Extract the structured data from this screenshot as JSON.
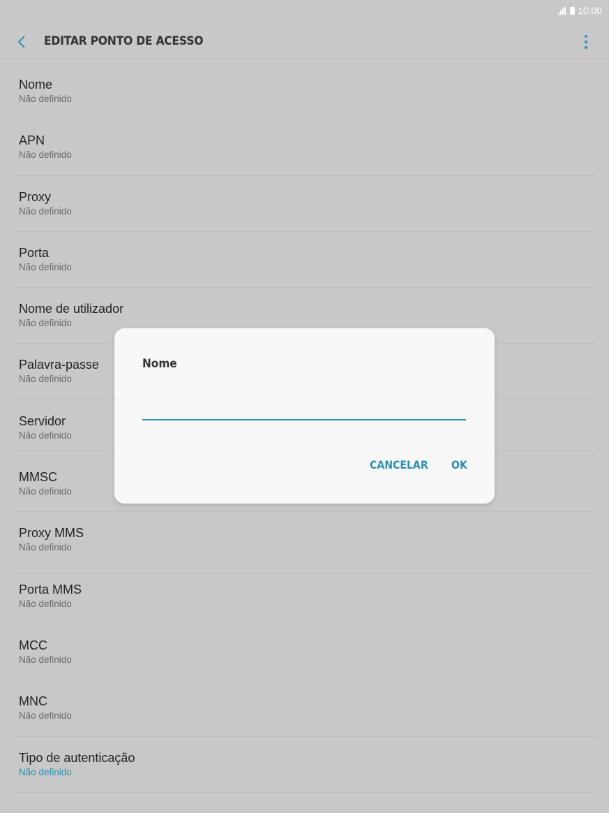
{
  "status_bar": {
    "time": "10:00"
  },
  "header": {
    "title": "EDITAR PONTO DE ACESSO",
    "back_icon": "chevron-left-icon",
    "menu_icon": "more-vert-icon"
  },
  "colors": {
    "accent": "#2a8fb0",
    "scrim_background": "#c8c8c8",
    "dialog_background": "#f8f8f8"
  },
  "settings": {
    "items": [
      {
        "label": "Nome",
        "value": "Não definido"
      },
      {
        "label": "APN",
        "value": "Não definido"
      },
      {
        "label": "Proxy",
        "value": "Não definido"
      },
      {
        "label": "Porta",
        "value": "Não definido"
      },
      {
        "label": "Nome de utilizador",
        "value": "Não definido"
      },
      {
        "label": "Palavra-passe",
        "value": "Não definido"
      },
      {
        "label": "Servidor",
        "value": "Não definido"
      },
      {
        "label": "MMSC",
        "value": "Não definido"
      },
      {
        "label": "Proxy MMS",
        "value": "Não definido"
      },
      {
        "label": "Porta MMS",
        "value": "Não definido"
      },
      {
        "label": "MCC",
        "value": "Não definido"
      },
      {
        "label": "MNC",
        "value": "Não definido"
      },
      {
        "label": "Tipo de autenticação",
        "value": "Não definido"
      }
    ]
  },
  "dialog": {
    "title": "Nome",
    "input_value": "",
    "cancel_label": "CANCELAR",
    "ok_label": "OK"
  }
}
